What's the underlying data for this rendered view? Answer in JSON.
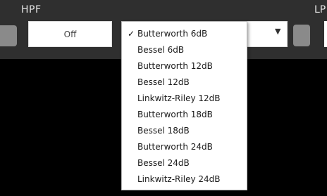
{
  "header": {
    "hpf_label": "HPF",
    "lpf_label_partial": "LP"
  },
  "hpf": {
    "frequency_value": "Off",
    "filter_type": {
      "selected": "Butterworth 6dB",
      "options": [
        "Butterworth 6dB",
        "Bessel 6dB",
        "Butterworth 12dB",
        "Bessel 12dB",
        "Linkwitz-Riley 12dB",
        "Butterworth 18dB",
        "Bessel 18dB",
        "Butterworth 24dB",
        "Bessel 24dB",
        "Linkwitz-Riley 24dB"
      ],
      "check_glyph": "✓",
      "arrow_glyph": "▼"
    }
  }
}
